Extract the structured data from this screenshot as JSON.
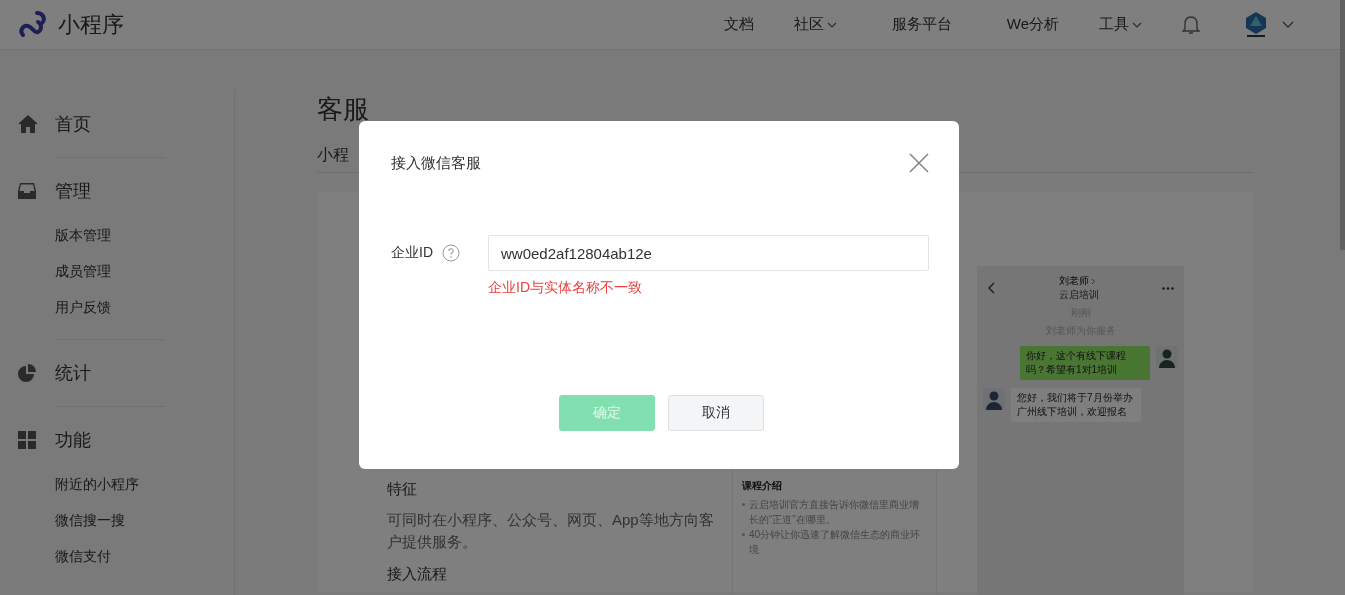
{
  "header": {
    "brand": "小程序",
    "nav": [
      {
        "label": "文档",
        "dropdown": false
      },
      {
        "label": "社区",
        "dropdown": true
      },
      {
        "label": "服务平台",
        "dropdown": false
      },
      {
        "label": "We分析",
        "dropdown": false
      },
      {
        "label": "工具",
        "dropdown": true
      }
    ]
  },
  "sidebar": {
    "groups": [
      {
        "label": "首页"
      },
      {
        "label": "管理",
        "items": [
          "版本管理",
          "成员管理",
          "用户反馈"
        ]
      },
      {
        "label": "统计"
      },
      {
        "label": "功能",
        "items": [
          "附近的小程序",
          "微信搜一搜",
          "微信支付"
        ]
      }
    ]
  },
  "page": {
    "title": "客服",
    "tab_label": "小程",
    "features": {
      "heading": "特征",
      "text": "可同时在小程序、公众号、网页、App等地方向客户提供服务。",
      "next_heading": "接入流程"
    },
    "course_card": {
      "title": "课程介绍",
      "bullets": [
        "云启培训官方直接告诉你微信里商业增长的“正道”在哪里。",
        "40分钟让你迅速了解微信生态的商业环境"
      ]
    },
    "chat_preview": {
      "contact": "刘老师",
      "subtitle": "云启培训",
      "time": "刚刚",
      "notice": "刘老师为你服务",
      "messages": [
        {
          "kind": "outgoing",
          "text": "你好，这个有线下课程吗？希望有1对1培训"
        },
        {
          "kind": "incoming",
          "text": "您好，我们将于7月份举办广州线下培训，欢迎报名"
        }
      ]
    }
  },
  "dialog": {
    "title": "接入微信客服",
    "field": {
      "label": "企业ID",
      "value": "ww0ed2af12804ab12e",
      "error": "企业ID与实体名称不一致"
    },
    "buttons": [
      {
        "label": "确定",
        "kind": "primary",
        "disabled": true
      },
      {
        "label": "取消",
        "kind": "default",
        "disabled": false
      }
    ]
  }
}
